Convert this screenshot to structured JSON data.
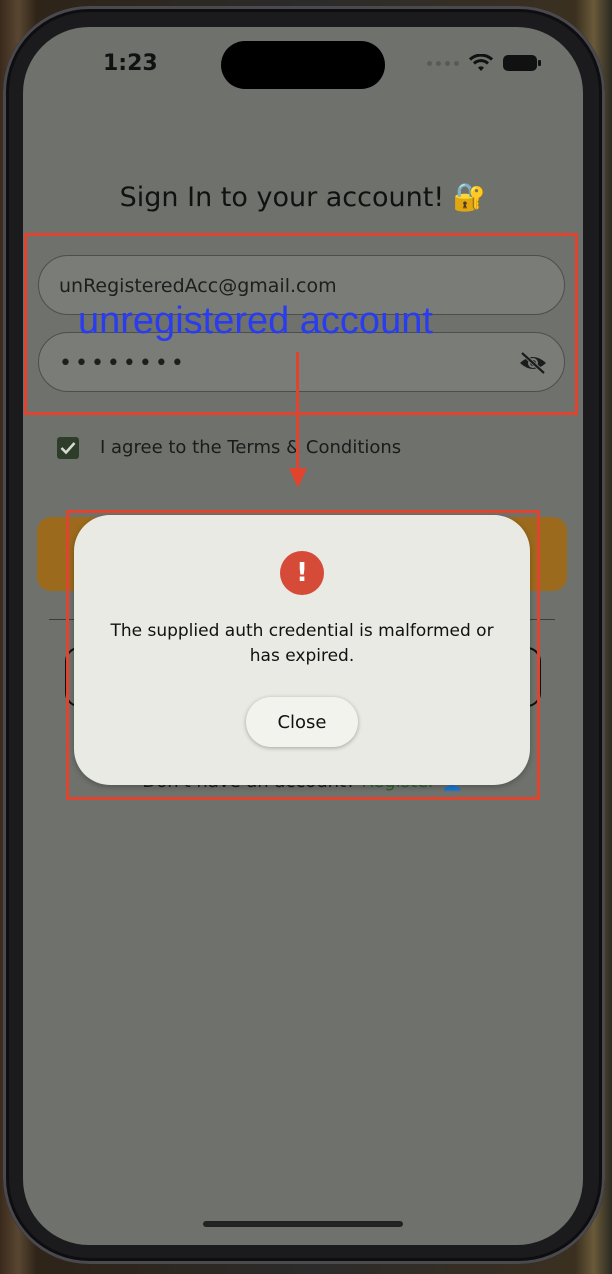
{
  "status_bar": {
    "time": "1:23"
  },
  "page": {
    "title": "Sign In to your account! 🔐",
    "email_value": "unRegisteredAcc@gmail.com",
    "password_value": "••••••••",
    "agree_label": "I agree to the Terms & Conditions",
    "agree_checked": true,
    "register_prompt": "Don't have an account? ",
    "register_link": "Register 👤"
  },
  "dialog": {
    "icon": "!",
    "message": "The supplied auth credential is malformed or has expired.",
    "close_label": "Close"
  },
  "annotation": {
    "label": "unregistered account",
    "color": "#e1442e",
    "label_color": "#2a3cf0"
  }
}
